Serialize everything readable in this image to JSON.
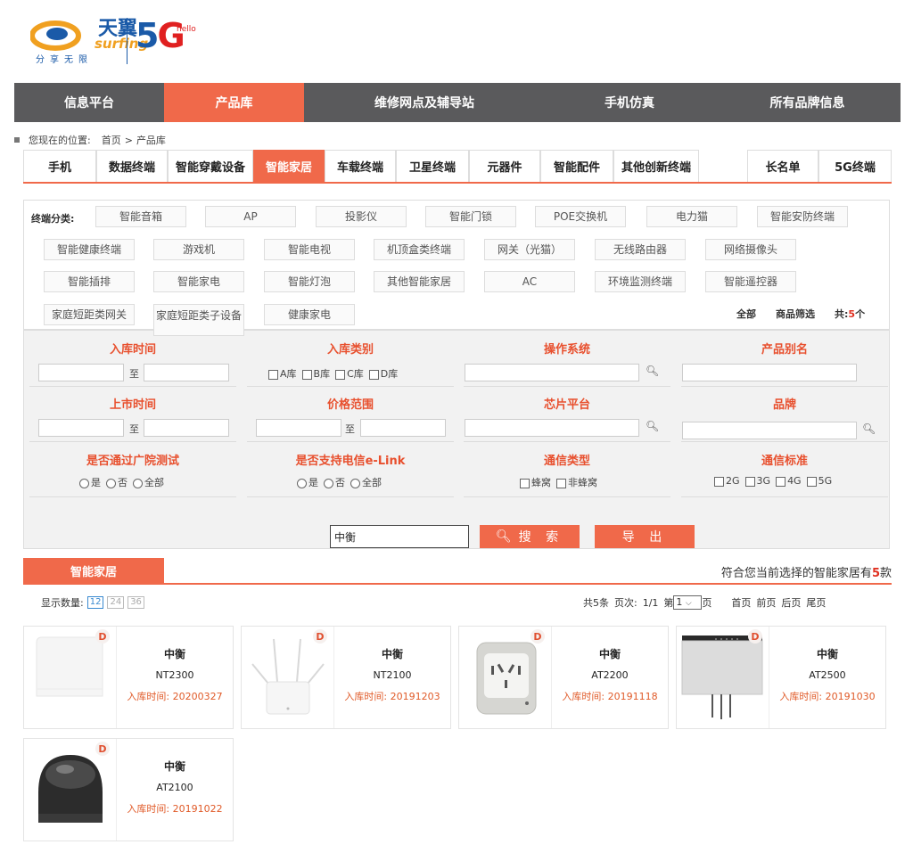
{
  "logo": {
    "brand_cn": "天翼",
    "brand_en": "surfing",
    "motto": "分享无限",
    "five": "5",
    "g": "G",
    "hello": "hello"
  },
  "nav": [
    "信息平台",
    "产品库",
    "维修网点及辅导站",
    "手机仿真",
    "所有品牌信息"
  ],
  "breadcrumb": {
    "prefix": "您现在的位置:",
    "home": "首页",
    "sep": ">",
    "current": "产品库"
  },
  "categories": [
    "手机",
    "数据终端",
    "智能穿戴设备",
    "智能家居",
    "车载终端",
    "卫星终端",
    "元器件",
    "智能配件",
    "其他创新终端",
    "长名单",
    "5G终端"
  ],
  "terminal_filter": {
    "label": "终端分类:",
    "chips": [
      "智能音箱",
      "AP",
      "投影仪",
      "智能门锁",
      "POE交换机",
      "电力猫",
      "智能安防终端",
      "智能健康终端",
      "游戏机",
      "智能电视",
      "机顶盒类终端",
      "网关（光猫）",
      "无线路由器",
      "网络摄像头",
      "智能插排",
      "智能家电",
      "智能灯泡",
      "其他智能家居",
      "AC",
      "环境监测终端",
      "智能遥控器",
      "家庭短距类网关",
      "家庭短距类子设备",
      "健康家电"
    ],
    "all": "全部",
    "screen": "商品筛选",
    "total_prefix": "共:",
    "total": "5",
    "total_suffix": "个"
  },
  "form": {
    "storage_time": "入库时间",
    "storage_type": "入库类别",
    "os": "操作系统",
    "alias": "产品别名",
    "launch_time": "上市时间",
    "price": "价格范围",
    "chip": "芯片平台",
    "brand": "品牌",
    "gy_test": "是否通过广院测试",
    "elink": "是否支持电信e-Link",
    "comm_type": "通信类型",
    "comm_std": "通信标准",
    "to": "至",
    "lib_opts": [
      "A库",
      "B库",
      "C库",
      "D库"
    ],
    "yn_opts": [
      "是",
      "否",
      "全部"
    ],
    "comm_type_opts": [
      "蜂窝",
      "非蜂窝"
    ],
    "comm_std_opts": [
      "2G",
      "3G",
      "4G",
      "5G"
    ],
    "keyword": "中衡",
    "search_btn": "搜 索",
    "export_btn": "导 出"
  },
  "results": {
    "tab": "智能家居",
    "count_prefix": "符合您当前选择的智能家居有",
    "count": "5",
    "count_suffix": "款",
    "show_label": "显示数量:",
    "page_sizes": [
      "12",
      "24",
      "36"
    ],
    "pager_total": "共5条",
    "pager_pages": "页次:",
    "pager_cur": "1/1",
    "pager_di": "第",
    "pager_sel": "1",
    "pager_ye": "页",
    "first": "首页",
    "prev": "前页",
    "next": "后页",
    "last": "尾页"
  },
  "products": [
    {
      "badge": "D",
      "brand": "中衡",
      "model": "NT2300",
      "date": "入库时间: 20200327"
    },
    {
      "badge": "D",
      "brand": "中衡",
      "model": "NT2100",
      "date": "入库时间: 20191203"
    },
    {
      "badge": "D",
      "brand": "中衡",
      "model": "AT2200",
      "date": "入库时间: 20191118"
    },
    {
      "badge": "D",
      "brand": "中衡",
      "model": "AT2500",
      "date": "入库时间: 20191030"
    },
    {
      "badge": "D",
      "brand": "中衡",
      "model": "AT2100",
      "date": "入库时间: 20191022"
    }
  ]
}
